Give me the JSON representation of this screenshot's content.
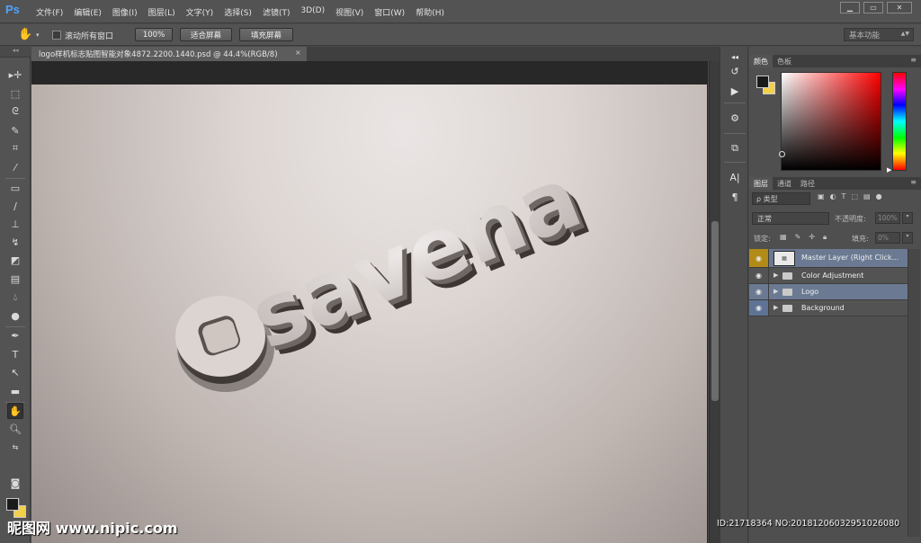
{
  "app": {
    "logo": "Ps"
  },
  "menu": {
    "items": [
      "文件(F)",
      "编辑(E)",
      "图像(I)",
      "图层(L)",
      "文字(Y)",
      "选择(S)",
      "滤镜(T)",
      "3D(D)",
      "视图(V)",
      "窗口(W)",
      "帮助(H)"
    ]
  },
  "window_controls": {
    "minimize": "▁",
    "restore": "▭",
    "close": "✕"
  },
  "options_bar": {
    "tool_icon": "hand-icon",
    "scroll_all_windows": {
      "label": "滚动所有窗口",
      "checked": false
    },
    "btn_100": "100%",
    "btn_fit": "适合屏幕",
    "btn_fill": "填充屏幕",
    "workspace": "基本功能"
  },
  "document": {
    "tab_title": "logo样机标志贴图智能对象4872.2200.1440.psd @ 44.4%(RGB/8)",
    "tab_close": "×",
    "artwork_text": "savena"
  },
  "colors": {
    "foreground": "#1a1a1a",
    "background": "#f2d04a",
    "accent_ps": "#4fa3ff",
    "selected_layer": "#6b7a92",
    "visibility_gold": "#b28a17"
  },
  "color_panel": {
    "tabs": [
      "颜色",
      "色板"
    ]
  },
  "layers_panel": {
    "tabs": [
      "图层",
      "通道",
      "路径"
    ],
    "filter_kind": "ρ 类型",
    "blend_mode": "正常",
    "opacity_label": "不透明度:",
    "opacity_value": "100%",
    "lock_label": "锁定:",
    "fill_label": "填充:",
    "fill_value": "0%",
    "layers": [
      {
        "name": "Master Layer (Right Click...",
        "type": "smart-object",
        "selected": true
      },
      {
        "name": "Color Adjustment",
        "type": "group",
        "selected": false
      },
      {
        "name": "Logo",
        "type": "group",
        "selected": true
      },
      {
        "name": "Background",
        "type": "group",
        "selected": false
      }
    ]
  },
  "watermark": {
    "left": "昵图网 www.nipic.com",
    "right": "ID:21718364 NO:20181206032951026080"
  }
}
